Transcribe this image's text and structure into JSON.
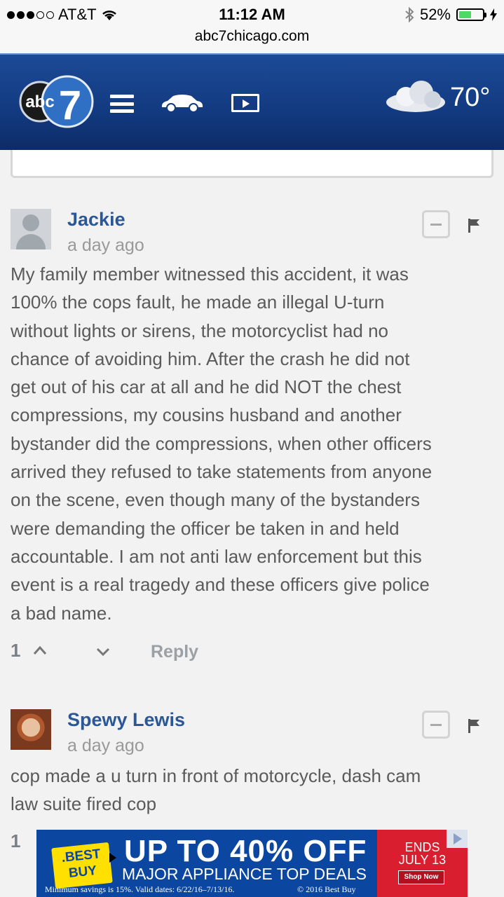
{
  "status_bar": {
    "carrier": "AT&T",
    "time": "11:12 AM",
    "battery_percent": "52%",
    "battery_level": 0.52,
    "url": "abc7chicago.com"
  },
  "header": {
    "logo_text": "abc",
    "logo_number": "7",
    "temperature": "70°",
    "accent_color": "#1c4a96"
  },
  "comments": [
    {
      "author": "Jackie",
      "time": "a day ago",
      "lines": [
        "My family member witnessed this accident, it was",
        "100% the cops fault, he made an illegal U-turn",
        "without lights or sirens, the motorcyclist had no",
        "chance of avoiding him. After the crash he did not",
        "get out of his car at all and he did NOT the chest",
        "compressions, my cousins husband and another",
        "bystander did the compressions, when other officers",
        "arrived they refused to take statements from anyone",
        "on the scene, even though many of the bystanders",
        "were demanding the officer be taken in and held",
        "accountable. I am not anti law enforcement but this",
        "event is a real tragedy and these officers give police",
        "a bad name."
      ],
      "votes": "1",
      "reply_label": "Reply"
    },
    {
      "author": "Spewy Lewis",
      "time": "a day ago",
      "lines": [
        "cop made a u turn in front of motorcycle, dash cam",
        "law suite fired cop"
      ],
      "votes": "1"
    }
  ],
  "ad": {
    "brand_line1": ".BEST",
    "brand_line2": "BUY",
    "headline": "UP TO 40% OFF",
    "subline": "MAJOR APPLIANCE TOP DEALS",
    "fine_print": "Minimum savings is 15%. Valid dates: 6/22/16–7/13/16.",
    "copyright": "© 2016 Best Buy",
    "ends_line1": "ENDS",
    "ends_line2": "JULY 13",
    "shop_now": "Shop Now"
  }
}
